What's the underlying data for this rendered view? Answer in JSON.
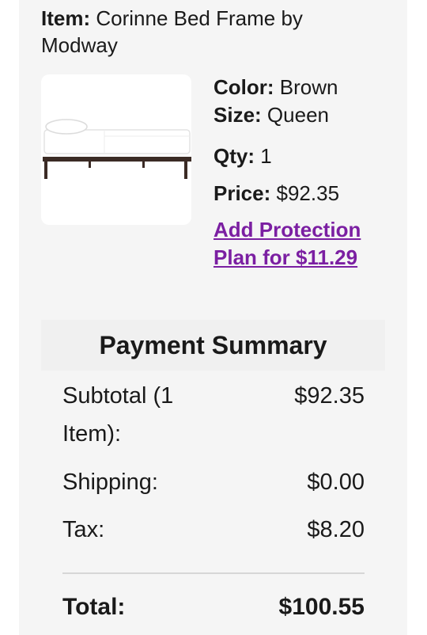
{
  "item": {
    "label": "Item:",
    "name": "Corinne Bed Frame by Modway"
  },
  "details": {
    "color_label": "Color:",
    "color_value": "Brown",
    "size_label": "Size:",
    "size_value": "Queen",
    "qty_label": "Qty:",
    "qty_value": "1",
    "price_label": "Price:",
    "price_value": "$92.35",
    "protection_link": "Add Protection Plan for $11.29"
  },
  "summary": {
    "title": "Payment Summary",
    "subtotal_label": "Subtotal (1 Item):",
    "subtotal_value": "$92.35",
    "shipping_label": "Shipping:",
    "shipping_value": "$0.00",
    "tax_label": "Tax:",
    "tax_value": "$8.20",
    "total_label": "Total:",
    "total_value": "$100.55"
  },
  "colors": {
    "link": "#7b1fa2",
    "panel_background": "#f5f5f5",
    "frame": "#3b2b25"
  },
  "image": {
    "icon": "bed-frame-product-image"
  }
}
